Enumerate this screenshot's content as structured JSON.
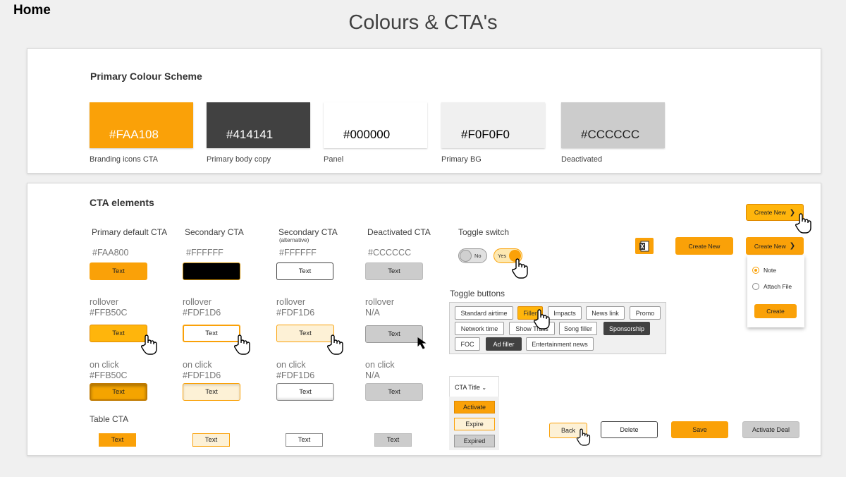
{
  "header": {
    "home": "Home",
    "title": "Colours & CTA's"
  },
  "palette": {
    "heading": "Primary Colour Scheme",
    "swatches": [
      {
        "hex": "#FAA108",
        "label": "Branding icons CTA",
        "bg": "#faa108",
        "fg": "#ffffff"
      },
      {
        "hex": "#414141",
        "label": "Primary body copy",
        "bg": "#414141",
        "fg": "#ffffff"
      },
      {
        "hex": "#000000",
        "label": "Panel",
        "bg": "#ffffff",
        "fg": "#000000"
      },
      {
        "hex": "#F0F0F0",
        "label": "Primary BG",
        "bg": "#f0f0f0",
        "fg": "#000000"
      },
      {
        "hex": "#CCCCCC",
        "label": "Deactivated",
        "bg": "#cccccc",
        "fg": "#222222"
      }
    ]
  },
  "cta": {
    "heading": "CTA elements",
    "columns": [
      {
        "title": "Primary default CTA",
        "sub": "",
        "hex": "#FAA800",
        "rollover_label": "rollover",
        "rollover_hex": "#FFB50C",
        "click_label": "on click",
        "click_hex": "#FFB50C"
      },
      {
        "title": "Secondary CTA",
        "sub": "",
        "hex": "#FFFFFF",
        "rollover_label": "rollover",
        "rollover_hex": "#FDF1D6",
        "click_label": "on click",
        "click_hex": "#FDF1D6"
      },
      {
        "title": "Secondary CTA",
        "sub": "(alternative)",
        "hex": "#FFFFFF",
        "rollover_label": "rollover",
        "rollover_hex": "#FDF1D6",
        "click_label": "on click",
        "click_hex": "#FDF1D6"
      },
      {
        "title": "Deactivated CTA",
        "sub": "",
        "hex": "#CCCCCC",
        "rollover_label": "rollover",
        "rollover_hex": "N/A",
        "click_label": "on click",
        "click_hex": "N/A"
      }
    ],
    "button_text": "Text",
    "table_cta_label": "Table CTA"
  },
  "toggle_switch": {
    "title": "Toggle switch",
    "off_label": "No",
    "on_label": "Yes"
  },
  "toggle_buttons": {
    "title": "Toggle buttons",
    "row1": [
      "Standard airtime",
      "Filler",
      "Impacts",
      "News link",
      "Promo"
    ],
    "row2": [
      "Network time",
      "Show Trails",
      "Song filler",
      "Sponsorship"
    ],
    "row3": [
      "FOC",
      "Ad filler",
      "Entertainment news"
    ]
  },
  "status_cta": {
    "title": "CTA Title",
    "items": [
      "Activate",
      "Expire",
      "Expired"
    ]
  },
  "create": {
    "label": "Create New",
    "options": [
      "Note",
      "Attach File"
    ],
    "confirm": "Create"
  },
  "actions": {
    "back": "Back",
    "delete": "Delete",
    "save": "Save",
    "activate": "Activate Deal"
  },
  "colors": {
    "accent": "#faa108",
    "rollover": "#ffb50c",
    "light": "#fdf1d6",
    "body": "#414141",
    "bg": "#f0f0f0",
    "disabled": "#cccccc"
  }
}
